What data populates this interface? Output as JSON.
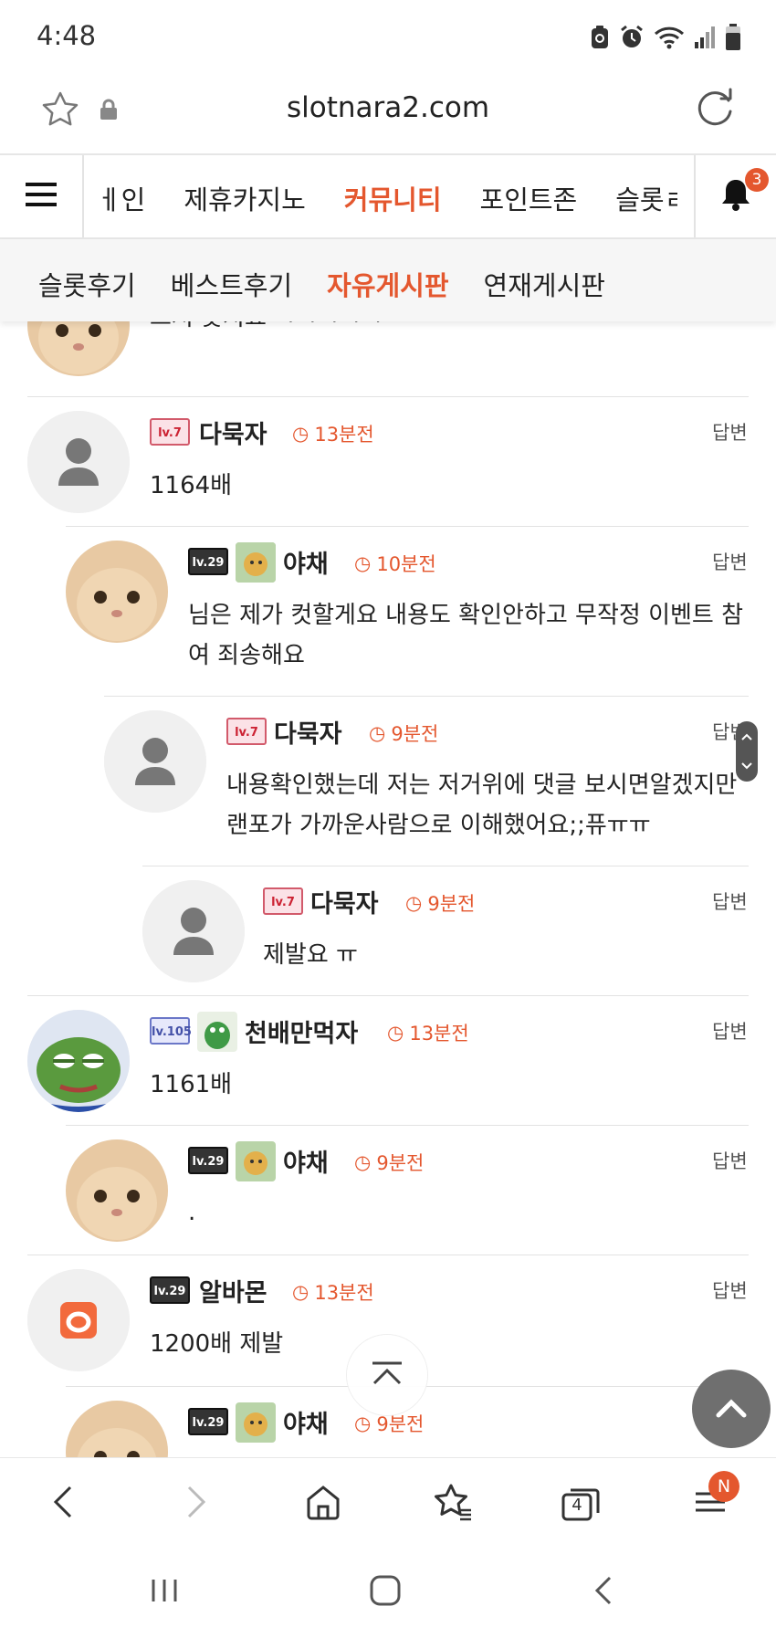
{
  "status_bar": {
    "time": "4:48"
  },
  "browser": {
    "url": "slotnara2.com",
    "tab_count": "4",
    "menu_badge": "N"
  },
  "main_nav": {
    "items": [
      "메인",
      "제휴카지노",
      "커뮤니티",
      "포인트존",
      "슬롯리뷰"
    ],
    "active": "커뮤니티",
    "visible_first": "ㅔ인",
    "visible_last": "슬롯ㄹ",
    "notification_count": "3"
  },
  "sub_nav": {
    "items": [
      "슬롯후기",
      "베스트후기",
      "자유게시판",
      "연재게시판"
    ],
    "active": "자유게시판"
  },
  "reply_label": "답변",
  "comments": [
    {
      "name": "",
      "time": "",
      "body": "그저 웃지요 ㅋㅋㅋㅋㅋ",
      "depth": 0
    },
    {
      "name": "다묵자",
      "time": "13분전",
      "body": "1164배",
      "depth": 0
    },
    {
      "name": "야채",
      "time": "10분전",
      "body": "님은 제가 컷할게요 내용도 확인안하고 무작정 이벤트 참여 죄송해요",
      "depth": 1
    },
    {
      "name": "다묵자",
      "time": "9분전",
      "body": "내용확인했는데 저는 저거위에 댓글 보시면알겠지만 랜포가 가까운사람으로 이해했어요;;퓨ㅠㅠ",
      "depth": 2
    },
    {
      "name": "다묵자",
      "time": "9분전",
      "body": "제발요 ㅠ",
      "depth": 3
    },
    {
      "name": "천배만먹자",
      "time": "13분전",
      "body": "1161배",
      "depth": 0
    },
    {
      "name": "야채",
      "time": "9분전",
      "body": ".",
      "depth": 1
    },
    {
      "name": "알바몬",
      "time": "13분전",
      "body": "1200배 제발",
      "depth": 0
    },
    {
      "name": "야채",
      "time": "9분전",
      "body": "",
      "depth": 1
    }
  ],
  "level_badges": {
    "pink": "lv.7",
    "dark": "lv.29",
    "blue": "lv.105"
  },
  "colors": {
    "accent": "#e4572e",
    "divider": "#e2e2e2",
    "sub_nav_bg": "#f6f6f6"
  }
}
